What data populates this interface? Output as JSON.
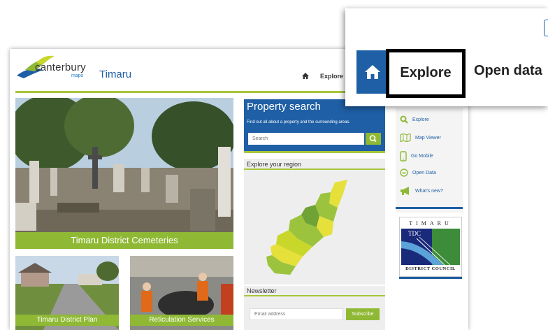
{
  "header": {
    "logo_text": "canterbury",
    "logo_sub": "maps",
    "region": "Timaru",
    "nav_explore": "Explore"
  },
  "hero": {
    "caption": "Timaru District Cemeteries"
  },
  "thumbs": [
    {
      "caption": "Timaru District Plan"
    },
    {
      "caption": "Reticulation Services"
    }
  ],
  "property_search": {
    "title": "Property search",
    "description": "Find out all about a property and the surrounding areas.",
    "placeholder": "Search"
  },
  "explore_region": {
    "title": "Explore your region"
  },
  "newsletter": {
    "title": "Newsletter",
    "placeholder": "Email address",
    "button": "Subscribe"
  },
  "sidebar": {
    "items": [
      {
        "label": "Explore",
        "icon": "search-icon"
      },
      {
        "label": "Map Viewer",
        "icon": "map-icon"
      },
      {
        "label": "Go Mobile",
        "icon": "mobile-icon"
      },
      {
        "label": "Open Data",
        "icon": "cc-icon"
      },
      {
        "label": "What's new?",
        "icon": "megaphone-icon"
      }
    ]
  },
  "council": {
    "top": "TIMARU",
    "abbr": "TDC",
    "bottom": "DISTRICT COUNCIL"
  },
  "zoom": {
    "explore": "Explore",
    "open_data": "Open data"
  },
  "colors": {
    "brand_blue": "#1f5fa5",
    "accent_green": "#8fb935",
    "rule_green": "#a8c73a"
  }
}
